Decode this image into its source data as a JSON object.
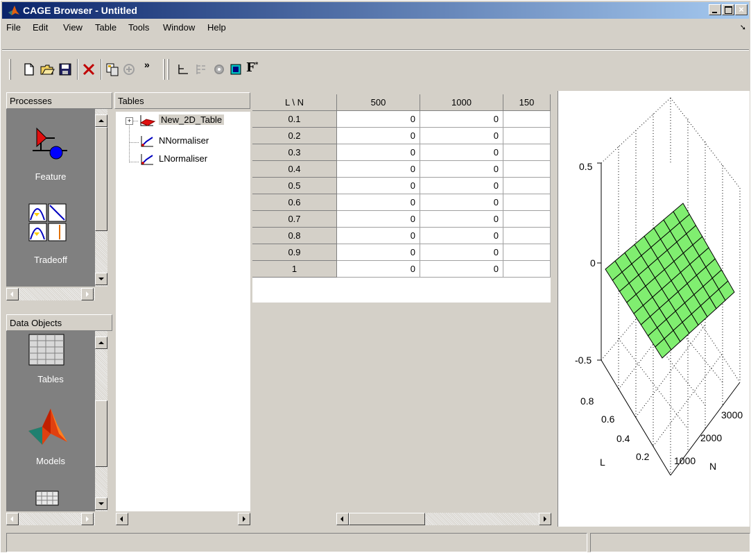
{
  "window": {
    "title": "CAGE Browser - Untitled"
  },
  "menu": [
    "File",
    "Edit",
    "View",
    "Table",
    "Tools",
    "Window",
    "Help"
  ],
  "toolbar": {
    "icons": [
      "new-file-icon",
      "open-folder-icon",
      "save-icon",
      "delete-icon",
      "copy-icon",
      "import-icon",
      "overflow-icon",
      "axis-icon",
      "tree-icon",
      "circle-icon",
      "color-icon",
      "formula-icon"
    ],
    "formula_label": "F",
    "overflow_label": "»"
  },
  "processes": {
    "header": "Processes",
    "items": [
      {
        "label": "Feature",
        "icon": "feature-icon"
      },
      {
        "label": "Tradeoff",
        "icon": "tradeoff-icon"
      }
    ]
  },
  "data_objects": {
    "header": "Data Objects",
    "items": [
      {
        "label": "Tables",
        "icon": "tables-icon"
      },
      {
        "label": "Models",
        "icon": "models-icon"
      }
    ]
  },
  "tables_tree": {
    "header": "Tables",
    "items": [
      {
        "label": "New_2D_Table",
        "icon": "table-2d-icon",
        "selected": true
      },
      {
        "label": "NNormaliser",
        "icon": "normaliser-icon"
      },
      {
        "label": "LNormaliser",
        "icon": "normaliser-icon"
      }
    ]
  },
  "grid": {
    "corner": "L \\ N",
    "columns": [
      "500",
      "1000",
      "150"
    ],
    "rows": [
      {
        "label": "0.1",
        "values": [
          "0",
          "0",
          ""
        ]
      },
      {
        "label": "0.2",
        "values": [
          "0",
          "0",
          ""
        ]
      },
      {
        "label": "0.3",
        "values": [
          "0",
          "0",
          ""
        ]
      },
      {
        "label": "0.4",
        "values": [
          "0",
          "0",
          ""
        ]
      },
      {
        "label": "0.5",
        "values": [
          "0",
          "0",
          ""
        ]
      },
      {
        "label": "0.6",
        "values": [
          "0",
          "0",
          ""
        ]
      },
      {
        "label": "0.7",
        "values": [
          "0",
          "0",
          ""
        ]
      },
      {
        "label": "0.8",
        "values": [
          "0",
          "0",
          ""
        ]
      },
      {
        "label": "0.9",
        "values": [
          "0",
          "0",
          ""
        ]
      },
      {
        "label": "1",
        "values": [
          "0",
          "0",
          ""
        ]
      }
    ]
  },
  "plot": {
    "z_ticks": [
      "0.5",
      "0",
      "-0.5"
    ],
    "l_ticks": [
      "0.8",
      "0.6",
      "0.4",
      "0.2"
    ],
    "n_ticks": [
      "3000",
      "2000",
      "1000"
    ],
    "l_label": "L",
    "n_label": "N",
    "surface_color": "#80ee70"
  }
}
